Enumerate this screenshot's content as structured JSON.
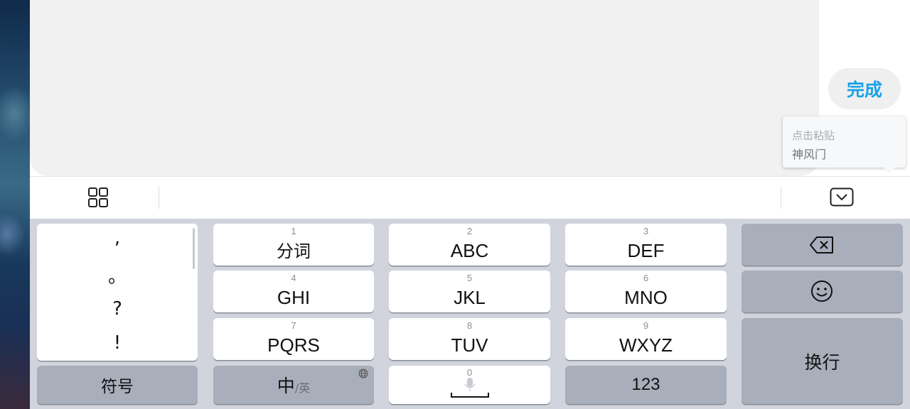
{
  "top": {
    "done_label": "完成",
    "paste_hint": "点击粘贴",
    "paste_content": "神风门"
  },
  "toolbar": {
    "left_icon": "grid-icon",
    "right_icon": "keyboard-collapse-icon"
  },
  "punctuation": [
    ",",
    "。",
    "?",
    "!"
  ],
  "keys": {
    "k1": {
      "num": "1",
      "label": "分词"
    },
    "k2": {
      "num": "2",
      "label": "ABC"
    },
    "k3": {
      "num": "3",
      "label": "DEF"
    },
    "k4": {
      "num": "4",
      "label": "GHI"
    },
    "k5": {
      "num": "5",
      "label": "JKL"
    },
    "k6": {
      "num": "6",
      "label": "MNO"
    },
    "k7": {
      "num": "7",
      "label": "PQRS"
    },
    "k8": {
      "num": "8",
      "label": "TUV"
    },
    "k9": {
      "num": "9",
      "label": "WXYZ"
    },
    "k0": {
      "num": "0"
    }
  },
  "bottom": {
    "symbols_label": "符号",
    "lang_primary": "中",
    "lang_secondary": "/英",
    "numbers_label": "123",
    "enter_label": "换行"
  },
  "colors": {
    "accent": "#19a2e6",
    "keyboard_bg": "#d1d4dc",
    "function_key": "#a9aebb"
  }
}
